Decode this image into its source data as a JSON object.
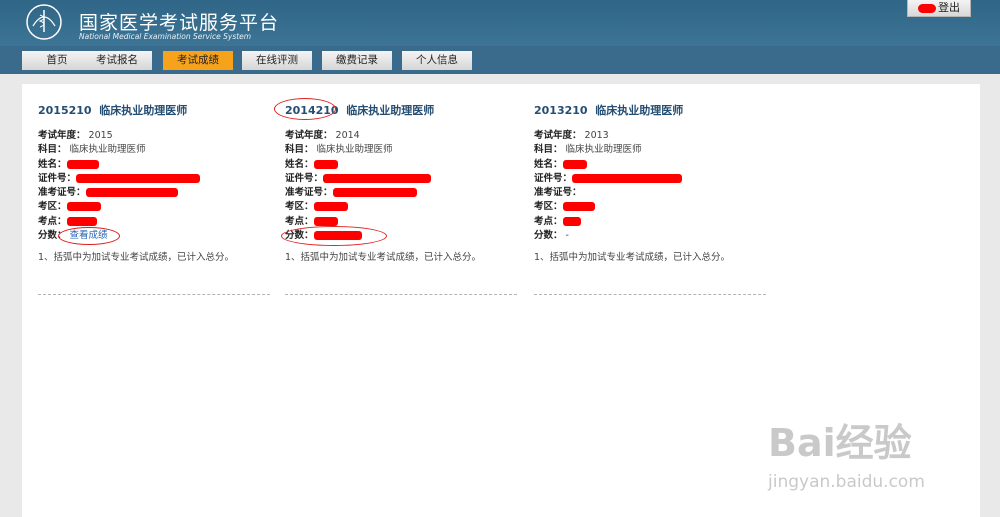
{
  "header": {
    "title": "国家医学考试服务平台",
    "subtitle": "National Medical Examination Service System",
    "logout_label": "登出"
  },
  "nav": {
    "items": [
      "首页",
      "考试报名",
      "考试成绩",
      "在线评测",
      "缴费记录",
      "个人信息"
    ],
    "active": "考试成绩"
  },
  "labels": {
    "year": "考试年度：",
    "subject": "科目：",
    "name": "姓名：",
    "id": "证件号：",
    "admission": "准考证号：",
    "region": "考区：",
    "site": "考点：",
    "score": "分数："
  },
  "exams": [
    {
      "code": "2015210",
      "title": "临床执业助理医师",
      "year": "2015",
      "subject": "临床执业助理医师",
      "score": "查看成绩",
      "note": "1、括弧中为加试专业考试成绩，已计入总分。"
    },
    {
      "code": "2014210",
      "title": "临床执业助理医师",
      "year": "2014",
      "subject": "临床执业助理医师",
      "score": "",
      "note": "1、括弧中为加试专业考试成绩，已计入总分。"
    },
    {
      "code": "2013210",
      "title": "临床执业助理医师",
      "year": "2013",
      "subject": "临床执业助理医师",
      "score": "-",
      "note": "1、括弧中为加试专业考试成绩，已计入总分。"
    }
  ],
  "watermark": {
    "brand": "Bai经验",
    "url": "jingyan.baidu.com"
  },
  "colors": {
    "header": "#3a6f90",
    "nav_active": "#f7a21b",
    "link": "#2a64b0",
    "redaction": "#ff0000",
    "annotation": "#e02020"
  }
}
